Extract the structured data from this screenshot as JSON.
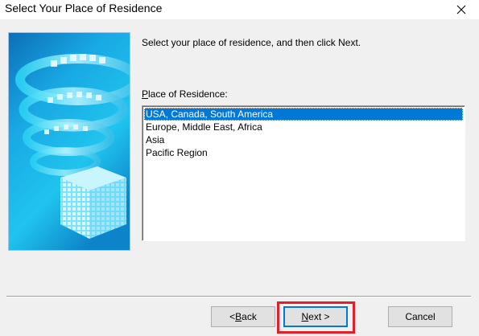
{
  "window": {
    "title": "Select Your Place of Residence",
    "close_icon": "close-icon"
  },
  "instruction": "Select your place of residence, and then click Next.",
  "list": {
    "label_accel": "P",
    "label_rest": "lace of Residence:",
    "items": [
      "USA, Canada, South America",
      "Europe, Middle East, Africa",
      "Asia",
      "Pacific Region"
    ],
    "selected_index": 0
  },
  "buttons": {
    "back_prefix": "< ",
    "back_accel": "B",
    "back_rest": "ack",
    "next_accel": "N",
    "next_rest": "ext >",
    "cancel": "Cancel"
  },
  "colors": {
    "selection": "#0078d7",
    "highlight_box": "#e0202a",
    "side_image_primary": "#1ab6e8"
  }
}
